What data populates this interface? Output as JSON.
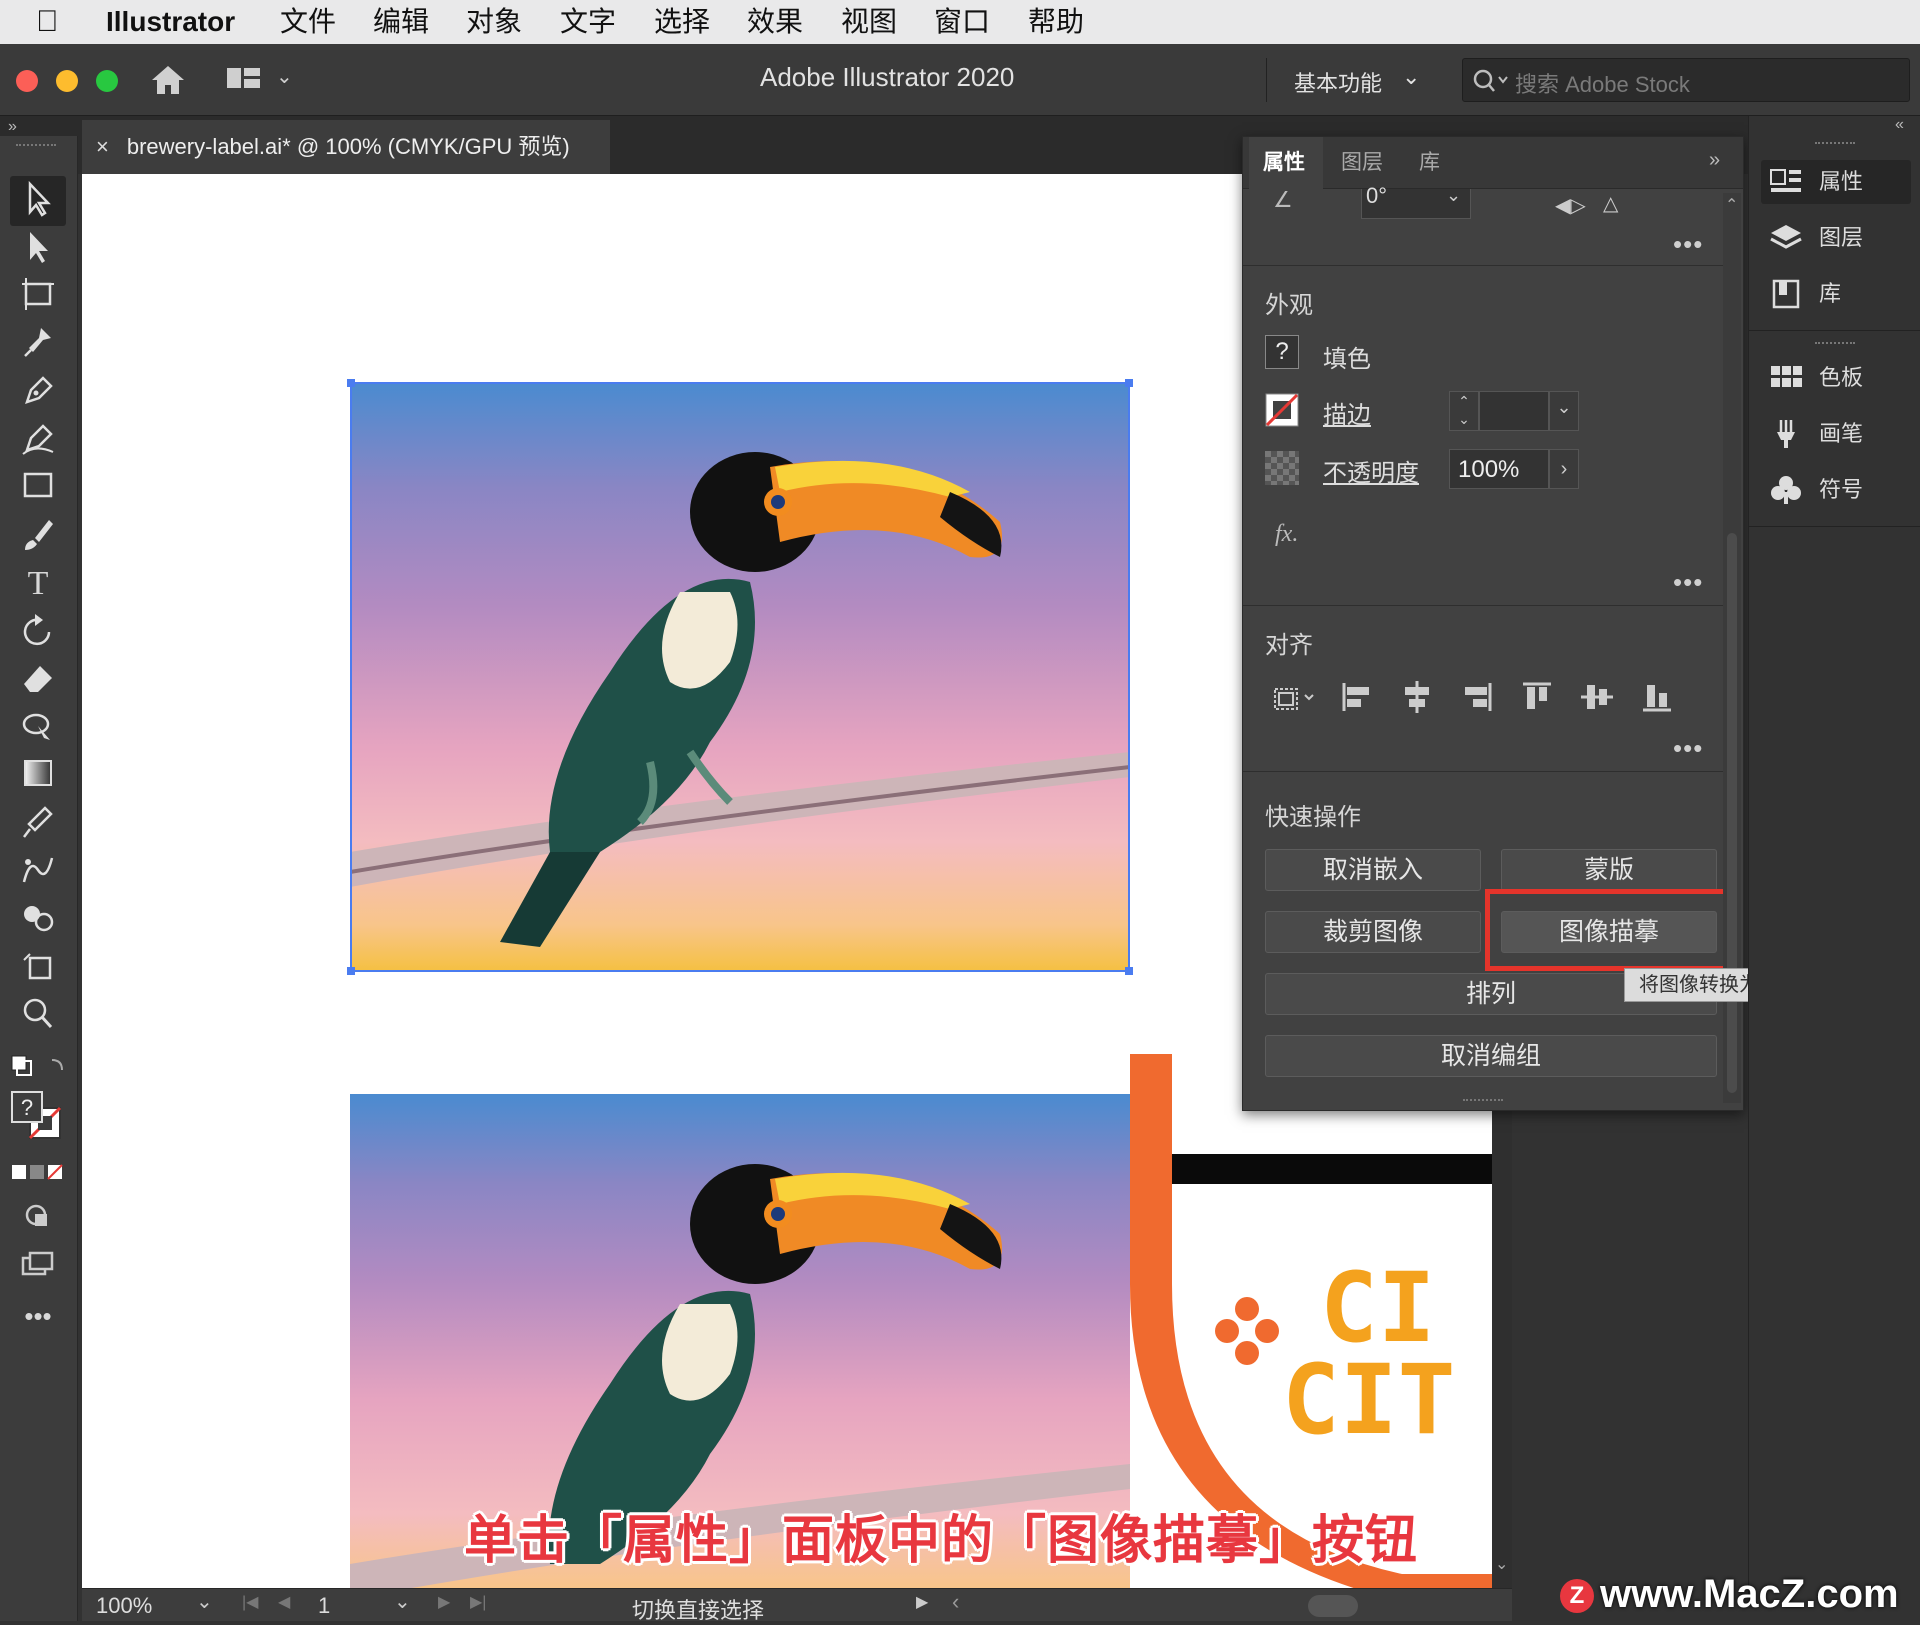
{
  "menubar": {
    "app_name": "Illustrator",
    "items": [
      "文件",
      "编辑",
      "对象",
      "文字",
      "选择",
      "效果",
      "视图",
      "窗口",
      "帮助"
    ]
  },
  "titlebar": {
    "title": "Adobe Illustrator 2020",
    "workspace": "基本功能",
    "search_placeholder": "搜索 Adobe Stock"
  },
  "document_tab": {
    "label": "brewery-label.ai* @ 100% (CMYK/GPU 预览)"
  },
  "properties_panel": {
    "tabs": [
      "属性",
      "图层",
      "库"
    ],
    "active_tab": "属性",
    "rotation_value": "0°",
    "appearance": {
      "title": "外观",
      "fill_label": "填色",
      "stroke_label": "描边",
      "opacity_label": "不透明度",
      "opacity_value": "100%",
      "fx_label": "fx."
    },
    "align": {
      "title": "对齐"
    },
    "quick_actions": {
      "title": "快速操作",
      "buttons": {
        "unembed": "取消嵌入",
        "mask": "蒙版",
        "crop": "裁剪图像",
        "image_trace": "图像描摹",
        "arrange": "排列",
        "ungroup": "取消编组"
      },
      "tooltip": "将图像转换为描摹对象"
    }
  },
  "right_panel": {
    "group1": [
      "属性",
      "图层",
      "库"
    ],
    "group2": [
      "色板",
      "画笔",
      "符号"
    ]
  },
  "statusbar": {
    "zoom": "100%",
    "page": "1",
    "mode": "切换直接选择"
  },
  "canvas": {
    "label_text_1": "CI",
    "label_text_2": "CIT",
    "label_accent": "#f06a2f",
    "label_gold": "#f4a21e"
  },
  "caption": "单击「属性」面板中的「图像描摹」按钮",
  "watermark": "www.MacZ.com",
  "colors": {
    "highlight": "#e5342b",
    "selection": "#4a7cf0"
  }
}
